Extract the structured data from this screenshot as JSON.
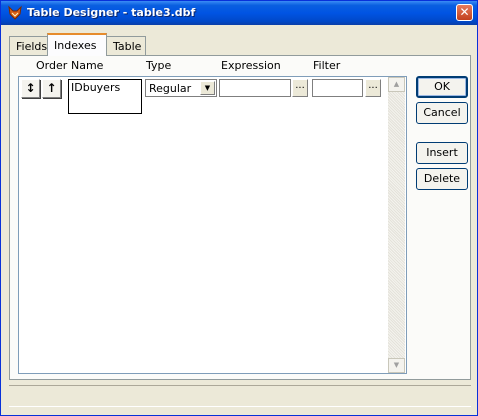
{
  "window": {
    "title": "Table Designer - table3.dbf",
    "close_glyph": "✕"
  },
  "tabs": [
    {
      "label": "Fields"
    },
    {
      "label": "Indexes",
      "selected": true
    },
    {
      "label": "Table"
    }
  ],
  "grid": {
    "columns": [
      "Order",
      "Name",
      "Type",
      "Expression",
      "Filter"
    ],
    "rows": [
      {
        "move_glyph": "↕",
        "order_glyph": "↑",
        "name": "IDbuyers",
        "type": "Regular",
        "expression": "",
        "filter": "",
        "ellipsis": "..."
      }
    ]
  },
  "buttons": {
    "ok": "OK",
    "cancel": "Cancel",
    "insert": "Insert",
    "delete": "Delete"
  },
  "colors": {
    "titlebar": "#0054e3",
    "face": "#ece9d8"
  },
  "icons": [
    "fox-app-icon",
    "close-icon",
    "move-arrows-icon",
    "sort-up-arrow-icon",
    "dropdown-arrow-icon",
    "scroll-up-icon",
    "scroll-down-icon"
  ]
}
